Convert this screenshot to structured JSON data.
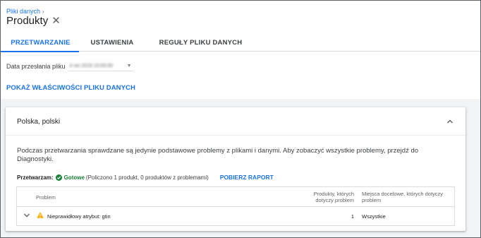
{
  "breadcrumb": {
    "parent": "Pliki danych"
  },
  "page": {
    "title": "Produkty"
  },
  "tabs": [
    {
      "label": "PRZETWARZANIE",
      "active": true
    },
    {
      "label": "USTAWIENIA",
      "active": false
    },
    {
      "label": "REGUŁY PLIKU DANYCH",
      "active": false
    }
  ],
  "upload": {
    "label": "Data przesłania pliku",
    "value": "4 sie 2019 10:00:00"
  },
  "props_link": "POKAŻ WŁAŚCIWOŚCI PLIKU DANYCH",
  "card": {
    "title": "Polska, polski",
    "info": "Podczas przetwarzania sprawdzane są jedynie podstawowe problemy z plikami i danymi. Aby zobaczyć wszystkie problemy, przejdź do Diagnostyki.",
    "status_label": "Przetwarzam:",
    "status_value": "Gotowe",
    "status_detail": "(Policzono 1 produkt, 0 produktów z problemami)",
    "report_link": "POBIERZ RAPORT"
  },
  "table": {
    "headers": {
      "problem": "Problem",
      "count": "Produkty, których dotyczy problem",
      "destinations": "Miejsca docelowe, których dotyczy problem"
    },
    "rows": [
      {
        "problem": "Nieprawidłowy atrybut: gtin",
        "count": "1",
        "destinations": "Wszystkie"
      }
    ]
  },
  "icons": {
    "close": "close-icon",
    "collapse": "chevron-up-icon",
    "expand": "chevron-down-icon",
    "status": "check-circle-icon",
    "warning": "warning-icon"
  },
  "colors": {
    "accent": "#1a73e8",
    "success": "#188038",
    "warning": "#f9ab00"
  }
}
